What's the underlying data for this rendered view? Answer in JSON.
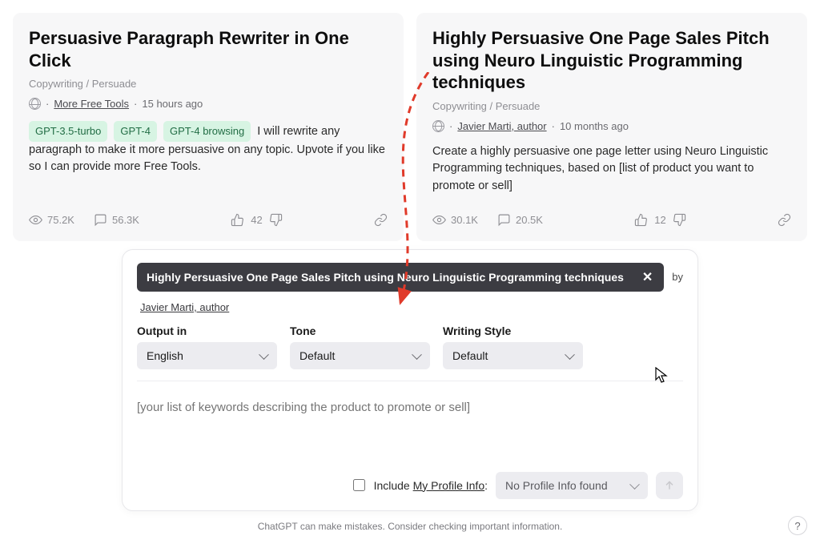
{
  "cards": [
    {
      "title": "Persuasive Paragraph Rewriter in One Click",
      "category": "Copywriting / Persuade",
      "author": "More Free Tools",
      "time": "15 hours ago",
      "models": [
        "GPT-3.5-turbo",
        "GPT-4",
        "GPT-4 browsing"
      ],
      "desc_after_models": "I will rewrite any paragraph to make it more persuasive on any topic. Upvote if you like so I can provide more Free Tools.",
      "views": "75.2K",
      "comments": "56.3K",
      "likes": "42"
    },
    {
      "title": "Highly Persuasive One Page Sales Pitch using Neuro Linguistic Programming techniques",
      "category": "Copywriting / Persuade",
      "author": "Javier Marti, author",
      "time": "10 months ago",
      "desc": "Create a highly persuasive one page letter using Neuro Linguistic Programming techniques, based on [list of product you want to promote or sell]",
      "views": "30.1K",
      "comments": "20.5K",
      "likes": "12"
    }
  ],
  "panel": {
    "pill_title": "Highly Persuasive One Page Sales Pitch using Neuro Linguistic Programming techniques",
    "by_label": "by",
    "author": "Javier Marti, author",
    "output_label": "Output in",
    "output_value": "English",
    "tone_label": "Tone",
    "tone_value": "Default",
    "style_label": "Writing Style",
    "style_value": "Default",
    "placeholder": "[your list of keywords describing the product to promote or sell]",
    "include_label_pre": "Include ",
    "include_label_link": "My Profile Info",
    "include_label_post": ":",
    "profile_value": "No Profile Info found"
  },
  "footer": {
    "disclaimer": "ChatGPT can make mistakes. Consider checking important information.",
    "help": "?"
  },
  "meta": {
    "dot": "·"
  }
}
